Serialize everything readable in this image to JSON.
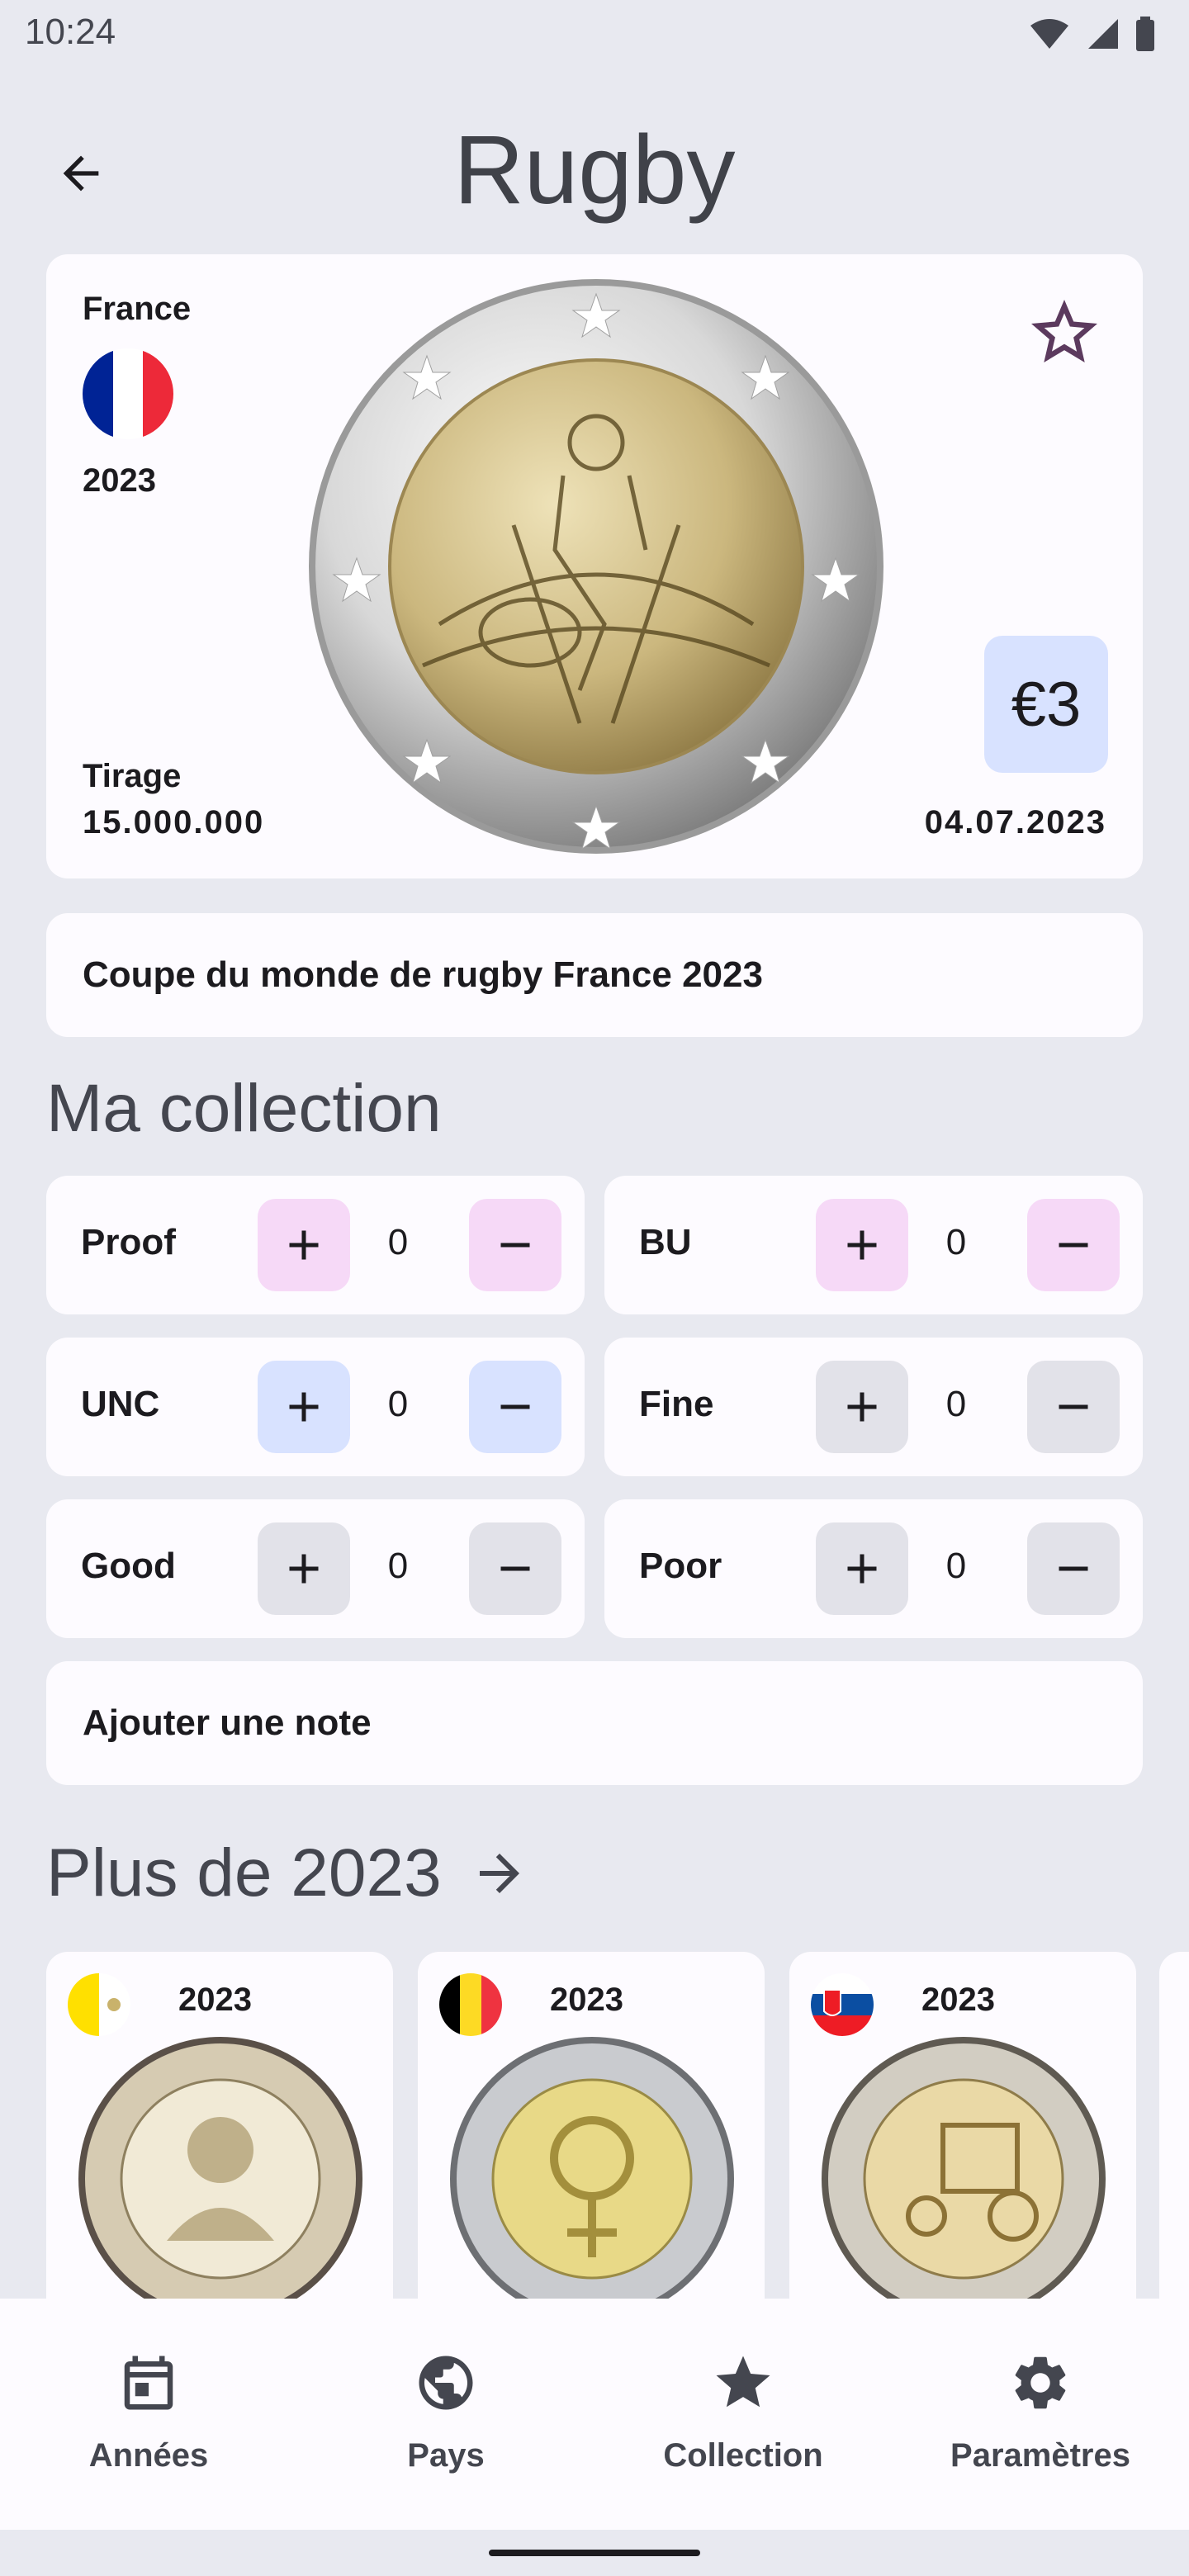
{
  "status_bar": {
    "time": "10:24"
  },
  "header": {
    "title": "Rugby"
  },
  "coin": {
    "country": "France",
    "year": "2023",
    "tirage_label": "Tirage",
    "tirage_value": "15.000.000",
    "date": "04.07.2023",
    "value": "€3",
    "flag_colors": [
      "#002395",
      "#ffffff",
      "#ed2939"
    ],
    "coin_image_alt": "coin-image"
  },
  "description": "Coupe du monde de rugby France 2023",
  "collection": {
    "title": "Ma collection",
    "grades": [
      {
        "label": "Proof",
        "count": "0",
        "color": "#f6d9f7"
      },
      {
        "label": "BU",
        "count": "0",
        "color": "#f6d9f7"
      },
      {
        "label": "UNC",
        "count": "0",
        "color": "#d8e2ff"
      },
      {
        "label": "Fine",
        "count": "0",
        "color": "#e2e2e9"
      },
      {
        "label": "Good",
        "count": "0",
        "color": "#e2e2e9"
      },
      {
        "label": "Poor",
        "count": "0",
        "color": "#e2e2e9"
      }
    ]
  },
  "note": {
    "label": "Ajouter une note"
  },
  "more": {
    "title": "Plus de 2023",
    "items": [
      {
        "year": "2023",
        "country_flag": "vatican"
      },
      {
        "year": "2023",
        "country_flag": "belgium"
      },
      {
        "year": "2023",
        "country_flag": "slovakia"
      }
    ]
  },
  "nav": {
    "items": [
      {
        "label": "Années",
        "icon": "calendar-icon"
      },
      {
        "label": "Pays",
        "icon": "globe-icon"
      },
      {
        "label": "Collection",
        "icon": "star-icon"
      },
      {
        "label": "Paramètres",
        "icon": "gear-icon"
      }
    ]
  }
}
